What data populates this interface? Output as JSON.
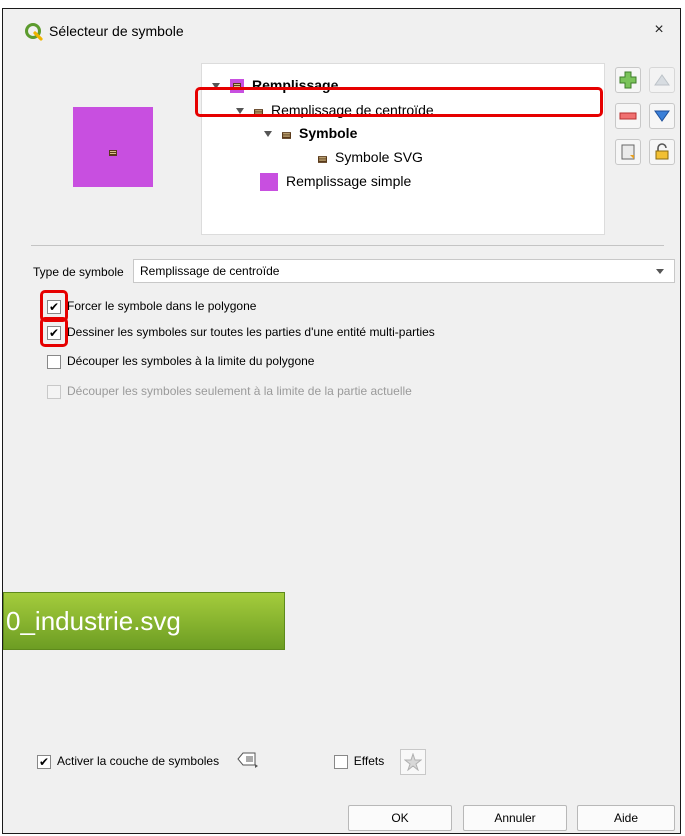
{
  "window": {
    "title": "Sélecteur de symbole",
    "close_glyph": "×"
  },
  "tree": {
    "items": [
      {
        "label": "Remplissage",
        "level": 0,
        "bold": true
      },
      {
        "label": "Remplissage de centroïde",
        "level": 1,
        "bold": false
      },
      {
        "label": "Symbole",
        "level": 2,
        "bold": true
      },
      {
        "label": "Symbole SVG",
        "level": 3,
        "bold": false
      },
      {
        "label": "Remplissage simple",
        "level": 1,
        "bold": false
      }
    ]
  },
  "symbol_type": {
    "label": "Type de symbole",
    "value": "Remplissage de centroïde"
  },
  "options": [
    {
      "label": "Forcer le symbole dans le polygone",
      "checked": true,
      "enabled": true
    },
    {
      "label": "Dessiner les symboles sur toutes les parties d'une entité multi-parties",
      "checked": true,
      "enabled": true
    },
    {
      "label": "Découper les symboles à la limite du polygone",
      "checked": false,
      "enabled": true
    },
    {
      "label": "Découper les symboles seulement à la limite de la partie actuelle",
      "checked": false,
      "enabled": false
    }
  ],
  "overlay_label": "0_industrie.svg",
  "bottom": {
    "enable_layer": {
      "label": "Activer la couche de symboles",
      "checked": true
    },
    "effects": {
      "label": "Effets",
      "checked": false
    }
  },
  "buttons": {
    "ok": "OK",
    "cancel": "Annuler",
    "help": "Aide"
  },
  "colors": {
    "fill": "#c84fe0",
    "highlight": "#e60000",
    "overlay": "#8bbb2f"
  }
}
